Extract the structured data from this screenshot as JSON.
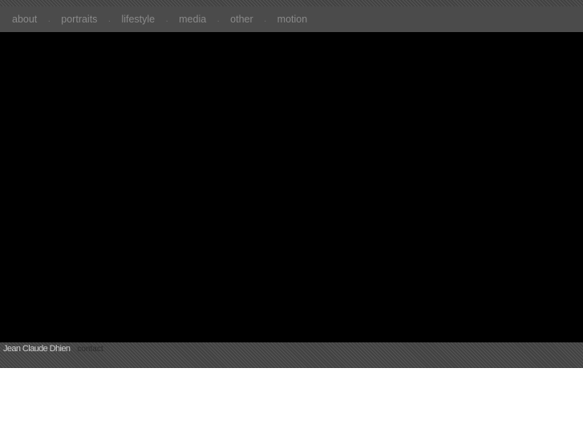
{
  "nav": {
    "items": [
      {
        "label": "about"
      },
      {
        "label": "portraits"
      },
      {
        "label": "lifestyle"
      },
      {
        "label": "media"
      },
      {
        "label": "other"
      },
      {
        "label": "motion"
      }
    ],
    "separator": "."
  },
  "footer": {
    "brand": "Jean Claude Dhien",
    "contact_label": "contact"
  },
  "colors": {
    "nav_bg": "#4b4b4b",
    "nav_text": "#8a8a8a",
    "stage_bg": "#000000",
    "page_bg": "#ffffff"
  }
}
